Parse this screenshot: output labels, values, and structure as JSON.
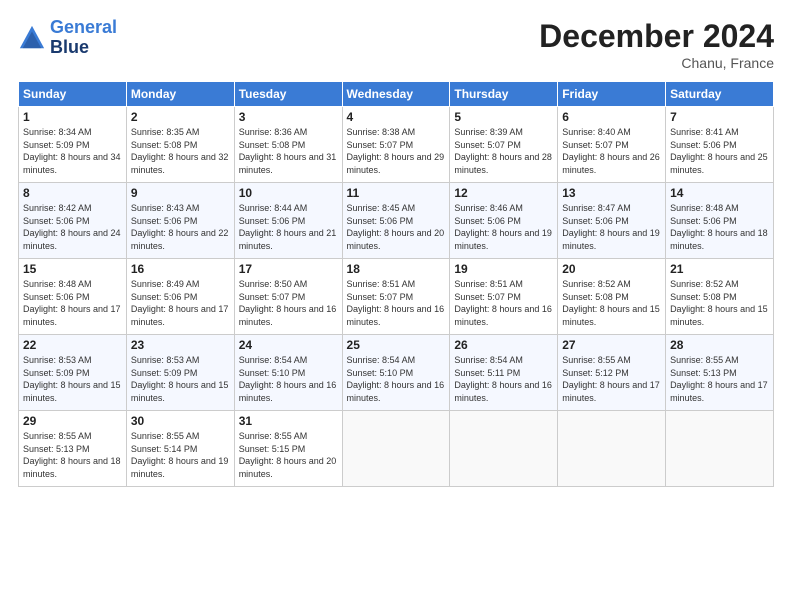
{
  "header": {
    "logo_line1": "General",
    "logo_line2": "Blue",
    "month": "December 2024",
    "location": "Chanu, France"
  },
  "days_of_week": [
    "Sunday",
    "Monday",
    "Tuesday",
    "Wednesday",
    "Thursday",
    "Friday",
    "Saturday"
  ],
  "weeks": [
    [
      {
        "day": "1",
        "sunrise": "8:34 AM",
        "sunset": "5:09 PM",
        "daylight": "8 hours and 34 minutes."
      },
      {
        "day": "2",
        "sunrise": "8:35 AM",
        "sunset": "5:08 PM",
        "daylight": "8 hours and 32 minutes."
      },
      {
        "day": "3",
        "sunrise": "8:36 AM",
        "sunset": "5:08 PM",
        "daylight": "8 hours and 31 minutes."
      },
      {
        "day": "4",
        "sunrise": "8:38 AM",
        "sunset": "5:07 PM",
        "daylight": "8 hours and 29 minutes."
      },
      {
        "day": "5",
        "sunrise": "8:39 AM",
        "sunset": "5:07 PM",
        "daylight": "8 hours and 28 minutes."
      },
      {
        "day": "6",
        "sunrise": "8:40 AM",
        "sunset": "5:07 PM",
        "daylight": "8 hours and 26 minutes."
      },
      {
        "day": "7",
        "sunrise": "8:41 AM",
        "sunset": "5:06 PM",
        "daylight": "8 hours and 25 minutes."
      }
    ],
    [
      {
        "day": "8",
        "sunrise": "8:42 AM",
        "sunset": "5:06 PM",
        "daylight": "8 hours and 24 minutes."
      },
      {
        "day": "9",
        "sunrise": "8:43 AM",
        "sunset": "5:06 PM",
        "daylight": "8 hours and 22 minutes."
      },
      {
        "day": "10",
        "sunrise": "8:44 AM",
        "sunset": "5:06 PM",
        "daylight": "8 hours and 21 minutes."
      },
      {
        "day": "11",
        "sunrise": "8:45 AM",
        "sunset": "5:06 PM",
        "daylight": "8 hours and 20 minutes."
      },
      {
        "day": "12",
        "sunrise": "8:46 AM",
        "sunset": "5:06 PM",
        "daylight": "8 hours and 19 minutes."
      },
      {
        "day": "13",
        "sunrise": "8:47 AM",
        "sunset": "5:06 PM",
        "daylight": "8 hours and 19 minutes."
      },
      {
        "day": "14",
        "sunrise": "8:48 AM",
        "sunset": "5:06 PM",
        "daylight": "8 hours and 18 minutes."
      }
    ],
    [
      {
        "day": "15",
        "sunrise": "8:48 AM",
        "sunset": "5:06 PM",
        "daylight": "8 hours and 17 minutes."
      },
      {
        "day": "16",
        "sunrise": "8:49 AM",
        "sunset": "5:06 PM",
        "daylight": "8 hours and 17 minutes."
      },
      {
        "day": "17",
        "sunrise": "8:50 AM",
        "sunset": "5:07 PM",
        "daylight": "8 hours and 16 minutes."
      },
      {
        "day": "18",
        "sunrise": "8:51 AM",
        "sunset": "5:07 PM",
        "daylight": "8 hours and 16 minutes."
      },
      {
        "day": "19",
        "sunrise": "8:51 AM",
        "sunset": "5:07 PM",
        "daylight": "8 hours and 16 minutes."
      },
      {
        "day": "20",
        "sunrise": "8:52 AM",
        "sunset": "5:08 PM",
        "daylight": "8 hours and 15 minutes."
      },
      {
        "day": "21",
        "sunrise": "8:52 AM",
        "sunset": "5:08 PM",
        "daylight": "8 hours and 15 minutes."
      }
    ],
    [
      {
        "day": "22",
        "sunrise": "8:53 AM",
        "sunset": "5:09 PM",
        "daylight": "8 hours and 15 minutes."
      },
      {
        "day": "23",
        "sunrise": "8:53 AM",
        "sunset": "5:09 PM",
        "daylight": "8 hours and 15 minutes."
      },
      {
        "day": "24",
        "sunrise": "8:54 AM",
        "sunset": "5:10 PM",
        "daylight": "8 hours and 16 minutes."
      },
      {
        "day": "25",
        "sunrise": "8:54 AM",
        "sunset": "5:10 PM",
        "daylight": "8 hours and 16 minutes."
      },
      {
        "day": "26",
        "sunrise": "8:54 AM",
        "sunset": "5:11 PM",
        "daylight": "8 hours and 16 minutes."
      },
      {
        "day": "27",
        "sunrise": "8:55 AM",
        "sunset": "5:12 PM",
        "daylight": "8 hours and 17 minutes."
      },
      {
        "day": "28",
        "sunrise": "8:55 AM",
        "sunset": "5:13 PM",
        "daylight": "8 hours and 17 minutes."
      }
    ],
    [
      {
        "day": "29",
        "sunrise": "8:55 AM",
        "sunset": "5:13 PM",
        "daylight": "8 hours and 18 minutes."
      },
      {
        "day": "30",
        "sunrise": "8:55 AM",
        "sunset": "5:14 PM",
        "daylight": "8 hours and 19 minutes."
      },
      {
        "day": "31",
        "sunrise": "8:55 AM",
        "sunset": "5:15 PM",
        "daylight": "8 hours and 20 minutes."
      },
      null,
      null,
      null,
      null
    ]
  ]
}
